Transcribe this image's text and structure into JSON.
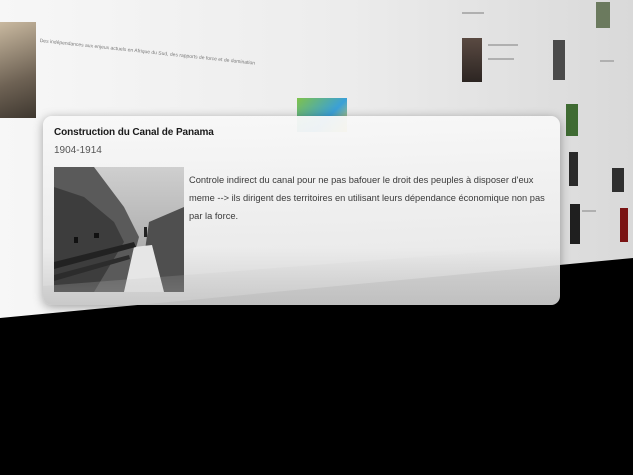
{
  "background": {
    "timeline_snippet": "Des indépendances aux enjeux actuels en Afrique du Sud, des rapports de force et de domination"
  },
  "card": {
    "title": "Construction du Canal de Panama",
    "date": "1904-1914",
    "image_alt": "Photographie noir et blanc des travaux du canal de Panama",
    "description": "Controle indirect du canal pour ne pas bafouer le droit des peuples à disposer d'eux meme --> ils dirigent des territoires en utilisant leurs dépendance économique non pas par la force."
  }
}
